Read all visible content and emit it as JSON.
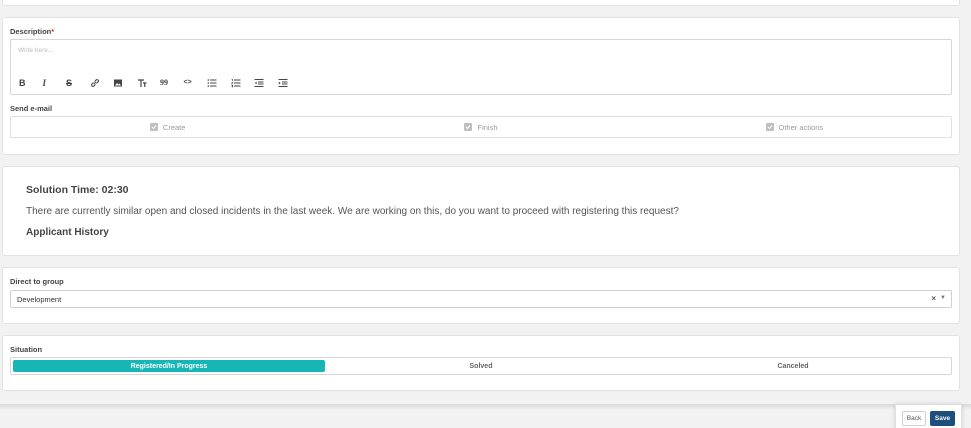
{
  "description": {
    "label": "Description",
    "required_mark": "*",
    "placeholder": "Write here...",
    "toolbar": [
      {
        "name": "bold-icon",
        "glyph": "B"
      },
      {
        "name": "italic-icon",
        "glyph": "I"
      },
      {
        "name": "strikethrough-icon",
        "glyph": "S"
      },
      {
        "name": "link-icon",
        "glyph": ""
      },
      {
        "name": "image-icon",
        "glyph": ""
      },
      {
        "name": "text-size-icon",
        "glyph": "T"
      },
      {
        "name": "quote-icon",
        "glyph": "99"
      },
      {
        "name": "code-icon",
        "glyph": "<>"
      },
      {
        "name": "bullet-list-icon",
        "glyph": ""
      },
      {
        "name": "numbered-list-icon",
        "glyph": ""
      },
      {
        "name": "outdent-icon",
        "glyph": ""
      },
      {
        "name": "indent-icon",
        "glyph": ""
      }
    ]
  },
  "send_email": {
    "label": "Send e-mail",
    "options": [
      {
        "label": "Create",
        "checked": true
      },
      {
        "label": "Finish",
        "checked": true
      },
      {
        "label": "Other actions",
        "checked": true
      }
    ]
  },
  "info": {
    "solution_time": "Solution Time: 02:30",
    "similar_text": "There are currently similar open and closed incidents in the last week. We are working on this, do you want to proceed with registering this request?",
    "applicant_history": "Applicant History"
  },
  "direct_group": {
    "label": "Direct to group",
    "value": "Development",
    "clear_glyph": "×",
    "caret_glyph": "▼"
  },
  "situation": {
    "label": "Situation",
    "options": [
      {
        "label": "Registered/In Progress",
        "active": true
      },
      {
        "label": "Solved",
        "active": false
      },
      {
        "label": "Canceled",
        "active": false
      }
    ]
  },
  "actions": {
    "back_label": "Back",
    "save_label": "Save"
  },
  "colors": {
    "accent": "#17b6b6",
    "primary_button": "#1c4e7e",
    "required": "#c0392b"
  }
}
